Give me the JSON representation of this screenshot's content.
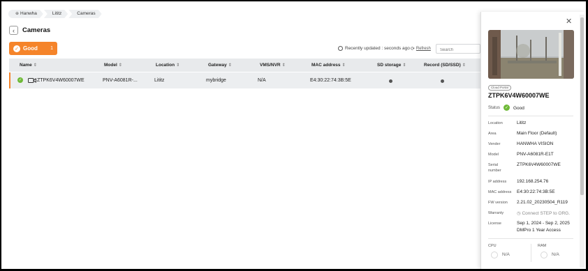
{
  "breadcrumb": [
    "Hanwha",
    "Lititz",
    "Cameras"
  ],
  "page_title": "Cameras",
  "status_filter": {
    "label": "Good",
    "count": "1"
  },
  "recently_updated": "Recently updated : seconds ago",
  "refresh_label": "Refresh",
  "search_placeholder": "Search",
  "table": {
    "columns": [
      "Name",
      "Model",
      "Location",
      "Gateway",
      "VMS/NVR",
      "MAC address",
      "SD storage",
      "Record (SD/SSD)"
    ],
    "rows": [
      {
        "name": "ZTPK6V4W60007WE",
        "model": "PNV-A6081R-...",
        "location": "Lititz",
        "gateway": "mybridge",
        "vms": "N/A",
        "mac": "E4:30:22:74:3B:5E",
        "sd_storage": "•",
        "record": "•"
      }
    ]
  },
  "panel": {
    "tag": "Cloud Portal",
    "title": "ZTPK6V4W60007WE",
    "status_label": "Status",
    "status_value": "Good",
    "fields": [
      {
        "k": "Location",
        "v": "Lititz"
      },
      {
        "k": "Area",
        "v": "Main Floor (Default)"
      },
      {
        "k": "Vender",
        "v": "HANWHA VISION"
      },
      {
        "k": "Model",
        "v": "PNV-A6081R-E1T"
      },
      {
        "k": "Serial",
        "k2": "number",
        "v": "ZTPK6V4W60007WE"
      },
      {
        "k": "IP address",
        "v": "192.168.254.76"
      },
      {
        "k": "MAC address",
        "v": "E4:30:22:74:3B:5E"
      },
      {
        "k": "FW version",
        "v": "2.21.02_20230504_R119"
      },
      {
        "k": "Warranty",
        "v": "Connect STEP to ORG."
      },
      {
        "k": "License",
        "v": "Sep 1, 2024 - Sep 2, 2025",
        "v2": "DMPro 1 Year Access"
      }
    ],
    "cpu_label": "CPU",
    "cpu_value": "N/A",
    "ram_label": "RAM",
    "ram_value": "N/A"
  },
  "colors": {
    "accent": "#f5842a",
    "good": "#6fba38"
  },
  "icons": [
    "globe-icon",
    "back-arrow-icon",
    "check-icon",
    "clock-icon",
    "refresh-icon",
    "camera-icon",
    "close-icon"
  ]
}
